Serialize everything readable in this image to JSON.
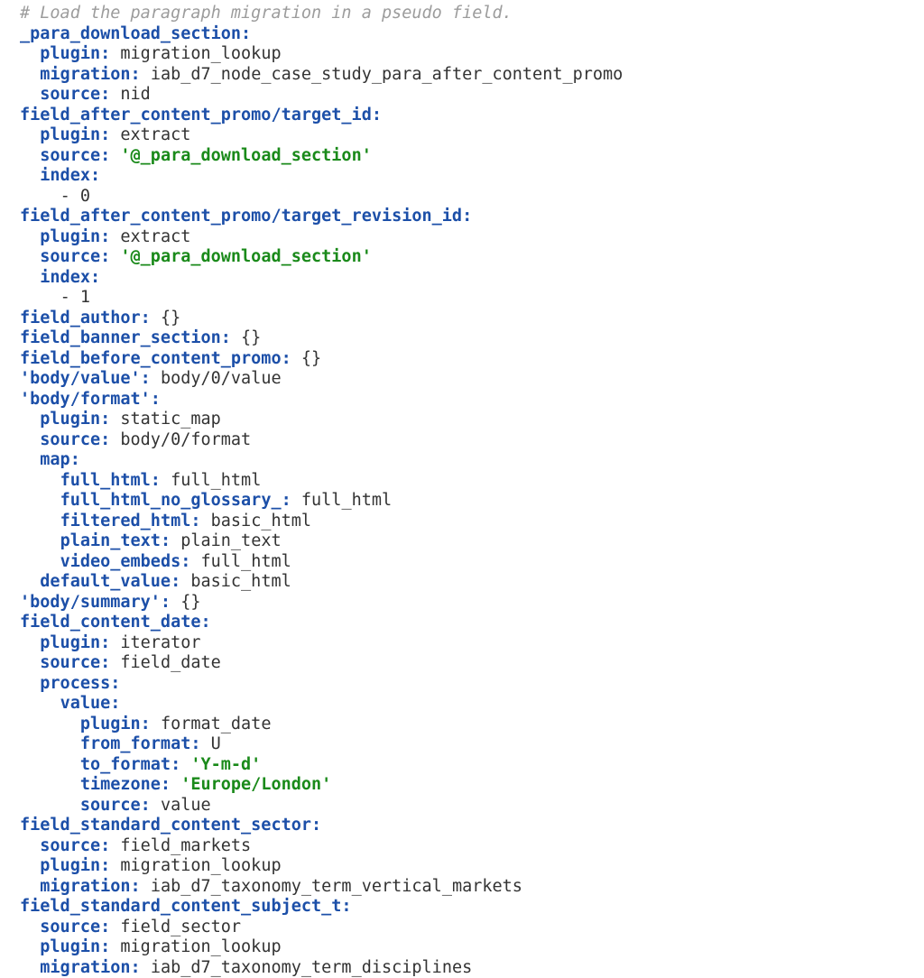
{
  "comment": "# Load the paragraph migration in a pseudo field.",
  "l1": {
    "key": "_para_download_section:"
  },
  "l2": {
    "key": "plugin:",
    "val": "migration_lookup"
  },
  "l3": {
    "key": "migration:",
    "val": "iab_d7_node_case_study_para_after_content_promo"
  },
  "l4": {
    "key": "source:",
    "val": "nid"
  },
  "l5": {
    "key": "field_after_content_promo/target_id:"
  },
  "l6": {
    "key": "plugin:",
    "val": "extract"
  },
  "l7": {
    "key": "source:",
    "val": "'@_para_download_section'"
  },
  "l8": {
    "key": "index:"
  },
  "l9": {
    "val": "- 0"
  },
  "l10": {
    "key": "field_after_content_promo/target_revision_id:"
  },
  "l11": {
    "key": "plugin:",
    "val": "extract"
  },
  "l12": {
    "key": "source:",
    "val": "'@_para_download_section'"
  },
  "l13": {
    "key": "index:"
  },
  "l14": {
    "val": "- 1"
  },
  "l15": {
    "key": "field_author:",
    "val": "{}"
  },
  "l16": {
    "key": "field_banner_section:",
    "val": "{}"
  },
  "l17": {
    "key": "field_before_content_promo:",
    "val": "{}"
  },
  "l18": {
    "key": "'body/value':",
    "val": "body/0/value"
  },
  "l19": {
    "key": "'body/format':"
  },
  "l20": {
    "key": "plugin:",
    "val": "static_map"
  },
  "l21": {
    "key": "source:",
    "val": "body/0/format"
  },
  "l22": {
    "key": "map:"
  },
  "l23": {
    "key": "full_html:",
    "val": "full_html"
  },
  "l24": {
    "key": "full_html_no_glossary_:",
    "val": "full_html"
  },
  "l25": {
    "key": "filtered_html:",
    "val": "basic_html"
  },
  "l26": {
    "key": "plain_text:",
    "val": "plain_text"
  },
  "l27": {
    "key": "video_embeds:",
    "val": "full_html"
  },
  "l28": {
    "key": "default_value:",
    "val": "basic_html"
  },
  "l29": {
    "key": "'body/summary':",
    "val": "{}"
  },
  "l30": {
    "key": "field_content_date:"
  },
  "l31": {
    "key": "plugin:",
    "val": "iterator"
  },
  "l32": {
    "key": "source:",
    "val": "field_date"
  },
  "l33": {
    "key": "process:"
  },
  "l34": {
    "key": "value:"
  },
  "l35": {
    "key": "plugin:",
    "val": "format_date"
  },
  "l36": {
    "key": "from_format:",
    "val": "U"
  },
  "l37": {
    "key": "to_format:",
    "val": "'Y-m-d'"
  },
  "l38": {
    "key": "timezone:",
    "val": "'Europe/London'"
  },
  "l39": {
    "key": "source:",
    "val": "value"
  },
  "l40": {
    "key": "field_standard_content_sector:"
  },
  "l41": {
    "key": "source:",
    "val": "field_markets"
  },
  "l42": {
    "key": "plugin:",
    "val": "migration_lookup"
  },
  "l43": {
    "key": "migration:",
    "val": "iab_d7_taxonomy_term_vertical_markets"
  },
  "l44": {
    "key": "field_standard_content_subject_t:"
  },
  "l45": {
    "key": "source:",
    "val": "field_sector"
  },
  "l46": {
    "key": "plugin:",
    "val": "migration_lookup"
  },
  "l47": {
    "key": "migration:",
    "val": "iab_d7_taxonomy_term_disciplines"
  }
}
